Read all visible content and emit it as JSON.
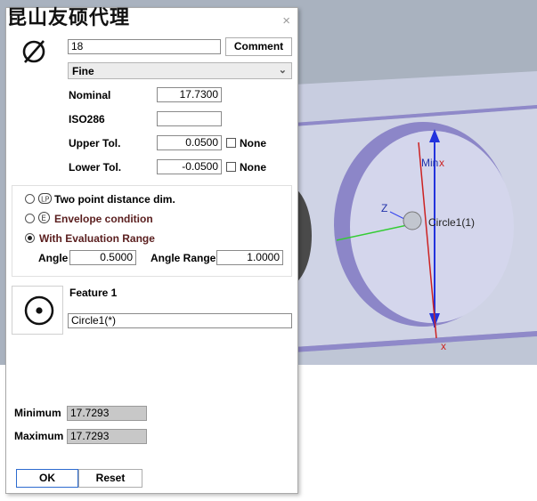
{
  "watermark": "昆山友硕代理",
  "dialog": {
    "close_glyph": "×",
    "symbol_icon": "diameter-icon",
    "id_value": "18",
    "comment_label": "Comment",
    "fit_select": "Fine",
    "nominal_label": "Nominal",
    "nominal_value": "17.7300",
    "iso_label": "ISO286",
    "iso_value": "",
    "upper_label": "Upper Tol.",
    "upper_value": "0.0500",
    "upper_none": "None",
    "lower_label": "Lower Tol.",
    "lower_value": "-0.0500",
    "lower_none": "None",
    "options": [
      {
        "icon": "two-point-icon",
        "label": "Two point distance dim.",
        "selected": false
      },
      {
        "icon": "envelope-e-icon",
        "label": "Envelope condition",
        "selected": false
      },
      {
        "icon": "",
        "label": "With Evaluation Range",
        "selected": true
      }
    ],
    "angle_label": "Angle",
    "angle_value": "0.5000",
    "angle_range_label": "Angle Range",
    "angle_range_value": "1.0000",
    "feature_icon": "circle-feature-icon",
    "feature_label": "Feature 1",
    "feature_value": "Circle1(*)",
    "minimum_label": "Minimum",
    "minimum_value": "17.7293",
    "maximum_label": "Maximum",
    "maximum_value": "17.7293",
    "ok_label": "OK",
    "reset_label": "Reset"
  },
  "viewport": {
    "min_label": "Min",
    "min_x": "x",
    "circle_label": "Circle1(1)",
    "z_label": "Z",
    "bottom_x": "x",
    "colors": {
      "background": "#a6b0bd",
      "part": "#cfd3e3",
      "hole": "#d3d5ea",
      "rim": "#8c86c8",
      "blue_axis": "#2233dd",
      "red_axis": "#cc2222",
      "green_axis": "#33cc33"
    }
  }
}
